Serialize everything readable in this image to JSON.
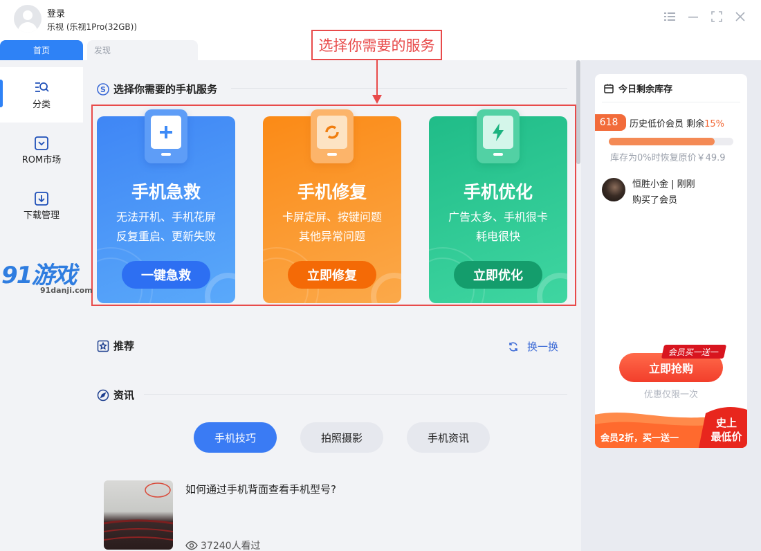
{
  "header": {
    "login_label": "登录",
    "device_label": "乐视 (乐视1Pro(32GB))"
  },
  "tabs": [
    {
      "label": "首页",
      "active": true
    },
    {
      "label": "发现",
      "active": false
    }
  ],
  "sidebar": {
    "items": [
      {
        "label": "分类",
        "icon": "category-search-icon",
        "active": true
      },
      {
        "label": "ROM市场",
        "icon": "rom-market-icon",
        "active": false
      },
      {
        "label": "下载管理",
        "icon": "download-icon",
        "active": false
      }
    ]
  },
  "annotation": {
    "label": "选择你需要的服务",
    "color": "#e84a4a"
  },
  "services": {
    "title": "选择你需要的手机服务",
    "cards": [
      {
        "title": "手机急救",
        "desc1": "无法开机、手机花屏",
        "desc2": "反复重启、更新失败",
        "button": "一键急救",
        "color": "#3d8af6"
      },
      {
        "title": "手机修复",
        "desc1": "卡屏定屏、按键问题",
        "desc2": "其他异常问题",
        "button": "立即修复",
        "color": "#fb8c1c"
      },
      {
        "title": "手机优化",
        "desc1": "广告太多、手机很卡",
        "desc2": "耗电很快",
        "button": "立即优化",
        "color": "#27bf8b"
      }
    ]
  },
  "recommend": {
    "title": "推荐",
    "refresh_label": "换一换"
  },
  "news": {
    "title": "资讯",
    "pills": [
      {
        "label": "手机技巧",
        "active": true
      },
      {
        "label": "拍照摄影",
        "active": false
      },
      {
        "label": "手机资讯",
        "active": false
      }
    ],
    "items": [
      {
        "title": "如何通过手机背面查看手机型号?",
        "views": "37240人看过"
      }
    ]
  },
  "watermark": {
    "text": "91游戏",
    "sub": "91danji.com"
  },
  "promo_panel": {
    "title": "今日剩余库存",
    "badge": "618",
    "stock_label": "历史低价会员  剩余",
    "stock_percent_text": "15%",
    "stock_percent": 15,
    "restore_text": "库存为0%时恢复原价￥49.9",
    "buyer_name": "恒胜小金 | 刚刚",
    "buyer_action": "购买了会员",
    "tag": "会员买一送一",
    "cta_button": "立即抢购",
    "cta_sub": "优惠仅限一次",
    "footer_text": "会员2折，买一送一",
    "footer_badge_1": "史上",
    "footer_badge_2": "最低价",
    "accent": "#f26b3a"
  }
}
